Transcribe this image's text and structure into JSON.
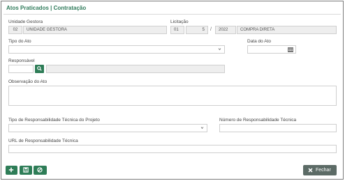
{
  "header": {
    "title": "Atos Praticados | Contratação"
  },
  "form": {
    "unidade_gestora": {
      "label": "Unidade Gestora",
      "code": "02",
      "name": "UNIDADE GESTORA"
    },
    "licitacao": {
      "label": "Licitação",
      "num1": "01",
      "num2": "5",
      "separator": "/",
      "year": "2022",
      "modalidade": "COMPRA DIRETA"
    },
    "tipo_ato": {
      "label": "Tipo do Ato",
      "value": ""
    },
    "data_ato": {
      "label": "Data do Ato",
      "value": ""
    },
    "responsavel": {
      "label": "Responsável",
      "code": "",
      "name": ""
    },
    "observacao": {
      "label": "Observação do Ato",
      "value": ""
    },
    "tipo_resp_tecnica": {
      "label": "Tipo de Responsabilidade Técnica do Projeto",
      "value": ""
    },
    "numero_resp_tecnica": {
      "label": "Número de Responsabilidade Técnica",
      "value": ""
    },
    "url_resp_tecnica": {
      "label": "URL de Responsabilidade Técnica",
      "value": ""
    }
  },
  "footer": {
    "close_label": "Fechar"
  },
  "icons": {
    "add": "plus-icon",
    "save": "floppy-icon",
    "cancel": "ban-icon",
    "close": "x-icon",
    "search": "search-icon",
    "calendar": "calendar-icon",
    "dropdown": "chevron-down-icon"
  },
  "colors": {
    "accent": "#2e7d57",
    "title": "#2f7a5a",
    "close_button": "#5c6b66"
  }
}
